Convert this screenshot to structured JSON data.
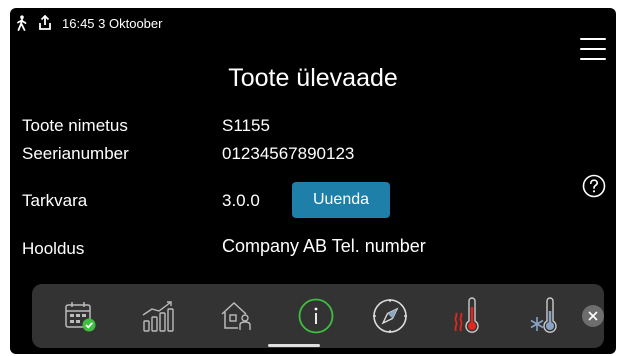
{
  "status_bar": {
    "time_date": "16:45 3 Oktoober",
    "icons": [
      "person-walking-icon",
      "upload-icon"
    ]
  },
  "header": {
    "title": "Toote ülevaade",
    "menu_icon": "hamburger-menu-icon"
  },
  "info": {
    "product_name_label": "Toote nimetus",
    "product_name_value": "S1155",
    "serial_label": "Seerianumber",
    "serial_value": "01234567890123",
    "software_label": "Tarkvara",
    "software_value": "3.0.0",
    "update_button": "Uuenda",
    "service_label": "Hooldus",
    "service_value": "Company AB Tel. number"
  },
  "help_icon": "question-circle-icon",
  "dock": {
    "items": [
      "calendar-check-icon",
      "bar-chart-icon",
      "house-person-icon",
      "info-circle-icon",
      "compass-icon",
      "thermometer-heating-icon",
      "thermometer-cooling-icon"
    ],
    "active_item": "info-circle-icon",
    "active_color": "#3fbf3f",
    "heating_color": "#e0281e",
    "cooling_color": "#8aa4c4",
    "close_icon": "close-icon"
  }
}
